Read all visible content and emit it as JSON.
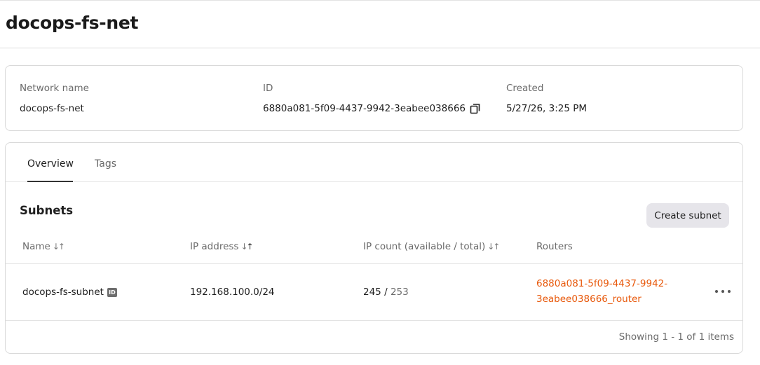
{
  "page": {
    "title": "docops-fs-net"
  },
  "details": {
    "network_name_label": "Network name",
    "network_name_value": "docops-fs-net",
    "id_label": "ID",
    "id_value": "6880a081-5f09-4437-9942-3eabee038666",
    "created_label": "Created",
    "created_value": "5/27/26, 3:25 PM"
  },
  "tabs": [
    {
      "label": "Overview",
      "active": true
    },
    {
      "label": "Tags",
      "active": false
    }
  ],
  "subnets": {
    "title": "Subnets",
    "create_label": "Create subnet",
    "columns": {
      "name": "Name",
      "ip": "IP address",
      "count": "IP count (available / total)",
      "routers": "Routers"
    },
    "rows": [
      {
        "name": "docops-fs-subnet",
        "badge": "ID",
        "ip": "192.168.100.0/24",
        "available": "245",
        "separator": "/",
        "total": "253",
        "router": "6880a081-5f09-4437-9942-3eabee038666_router"
      }
    ],
    "footer": "Showing 1 - 1 of 1 items"
  },
  "colors": {
    "accent_link": "#e8590c",
    "button_bg": "#e6e5ea",
    "border": "#d9d9d9"
  }
}
